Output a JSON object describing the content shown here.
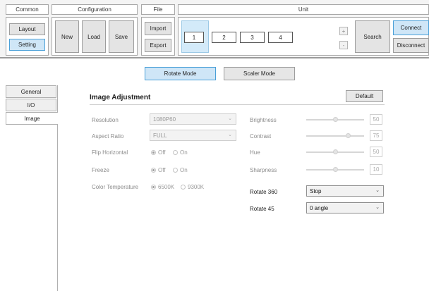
{
  "toolbar": {
    "common": {
      "title": "Common",
      "layout": "Layout",
      "setting": "Setting"
    },
    "configuration": {
      "title": "Configuration",
      "new": "New",
      "load": "Load",
      "save": "Save"
    },
    "file": {
      "title": "File",
      "import": "Import",
      "export": "Export"
    },
    "unit": {
      "title": "Unit",
      "units": [
        "1",
        "2",
        "3",
        "4"
      ],
      "plus": "+",
      "minus": "-",
      "search": "Search",
      "connect": "Connect",
      "disconnect": "Disconnect"
    }
  },
  "modes": {
    "rotate": "Rotate Mode",
    "scaler": "Scaler Mode",
    "active": "rotate"
  },
  "tabs": [
    "General",
    "I/O",
    "Image"
  ],
  "active_tab": "Image",
  "panel": {
    "title": "Image Adjustment",
    "default_button": "Default",
    "resolution": {
      "label": "Resolution",
      "value": "1080P60"
    },
    "aspect_ratio": {
      "label": "Aspect Ratio",
      "value": "FULL"
    },
    "flip_horizontal": {
      "label": "Flip Horizontal",
      "off": "Off",
      "on": "On",
      "selected": "Off"
    },
    "freeze": {
      "label": "Freeze",
      "off": "Off",
      "on": "On",
      "selected": "Off"
    },
    "color_temperature": {
      "label": "Color Temperature",
      "opt1": "6500K",
      "opt2": "9300K",
      "selected": "6500K"
    },
    "brightness": {
      "label": "Brightness",
      "value": "50",
      "level": 0.5
    },
    "contrast": {
      "label": "Contrast",
      "value": "75",
      "level": 0.75
    },
    "hue": {
      "label": "Hue",
      "value": "50",
      "level": 0.5
    },
    "sharpness": {
      "label": "Sharpness",
      "value": "10",
      "level": 0.5
    },
    "rotate_360": {
      "label": "Rotate 360",
      "value": "Stop"
    },
    "rotate_45": {
      "label": "Rotate 45",
      "value": "0 angle"
    }
  },
  "colors": {
    "accent_bg": "#cfe6f7",
    "accent_border": "#4aa0d8"
  }
}
